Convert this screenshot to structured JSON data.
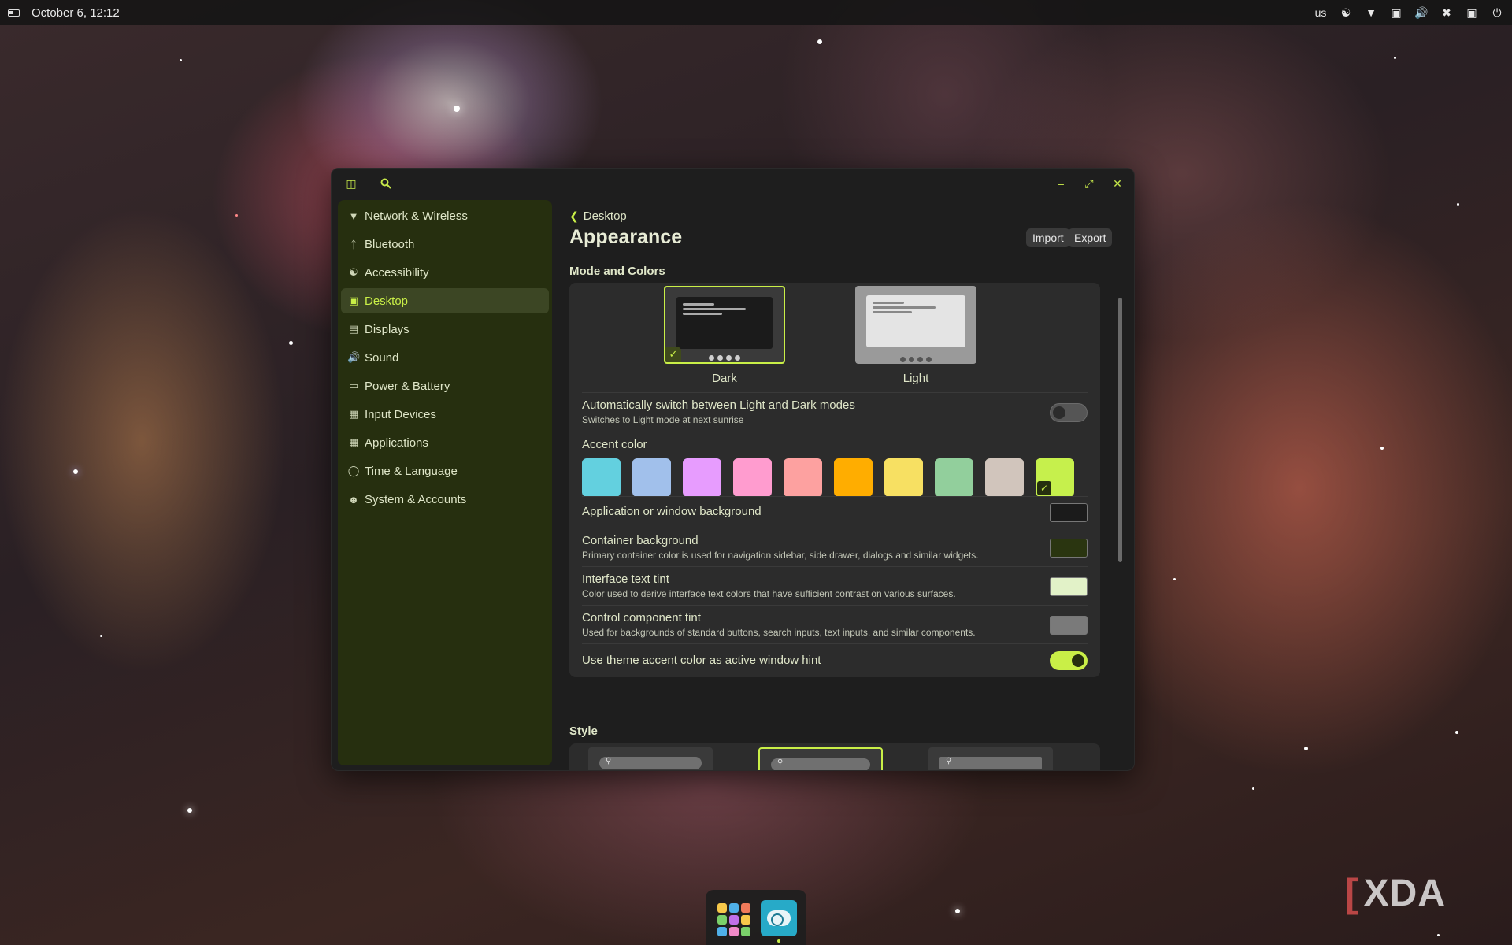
{
  "top_panel": {
    "datetime": "October 6, 12:12",
    "keyboard_layout": "us",
    "tray_icons": [
      "accessibility-icon",
      "wifi-icon",
      "display-icon",
      "volume-icon",
      "bluetooth-off-icon",
      "notifications-icon",
      "power-icon"
    ]
  },
  "window": {
    "header_icons": [
      "sidebar-toggle-icon",
      "search-icon"
    ],
    "controls": [
      "minimize",
      "maximize",
      "close"
    ]
  },
  "sidebar": {
    "items": [
      {
        "label": "Network & Wireless",
        "icon": "wifi-icon",
        "active": false
      },
      {
        "label": "Bluetooth",
        "icon": "bluetooth-icon",
        "active": false
      },
      {
        "label": "Accessibility",
        "icon": "accessibility-icon",
        "active": false
      },
      {
        "label": "Desktop",
        "icon": "desktop-icon",
        "active": true
      },
      {
        "label": "Displays",
        "icon": "displays-icon",
        "active": false
      },
      {
        "label": "Sound",
        "icon": "sound-icon",
        "active": false
      },
      {
        "label": "Power & Battery",
        "icon": "battery-icon",
        "active": false
      },
      {
        "label": "Input Devices",
        "icon": "keyboard-icon",
        "active": false
      },
      {
        "label": "Applications",
        "icon": "apps-icon",
        "active": false
      },
      {
        "label": "Time & Language",
        "icon": "globe-icon",
        "active": false
      },
      {
        "label": "System & Accounts",
        "icon": "accounts-icon",
        "active": false
      }
    ]
  },
  "content": {
    "breadcrumb": "Desktop",
    "title": "Appearance",
    "import_label": "Import",
    "export_label": "Export",
    "mode_section": "Mode and Colors",
    "modes": [
      {
        "label": "Dark",
        "selected": true
      },
      {
        "label": "Light",
        "selected": false
      }
    ],
    "auto_switch": {
      "title": "Automatically switch between Light and Dark modes",
      "subtitle": "Switches to Light mode at next sunrise",
      "enabled": false
    },
    "accent": {
      "title": "Accent color",
      "colors": [
        "#63d0df",
        "#a1c0eb",
        "#e79cfe",
        "#ff9ccf",
        "#fda1a0",
        "#ffad00",
        "#f7e062",
        "#92cf9c",
        "#d1c5bc",
        "#c6f04c"
      ],
      "selected_index": 9
    },
    "app_background": {
      "title": "Application or window background",
      "color": "#1b1b1b"
    },
    "container_background": {
      "title": "Container background",
      "subtitle": "Primary container color is used for navigation sidebar, side drawer, dialogs and similar widgets.",
      "color": "#2a3510"
    },
    "text_tint": {
      "title": "Interface text tint",
      "subtitle": "Color used to derive interface text colors that have sufficient contrast on various surfaces.",
      "color": "#e2f2c8"
    },
    "control_tint": {
      "title": "Control component tint",
      "subtitle": "Used for backgrounds of standard buttons, search inputs, text inputs, and similar components.",
      "color": "#7a7a7a"
    },
    "window_hint": {
      "title": "Use theme accent color as active window hint",
      "enabled": true
    },
    "style_section": "Style",
    "style_selected_index": 1
  },
  "watermark": "XDA",
  "colors": {
    "accent": "#c9ef47",
    "sidebar": "#262f0f",
    "window": "#1e1e1e",
    "card": "#2c2c2c"
  }
}
